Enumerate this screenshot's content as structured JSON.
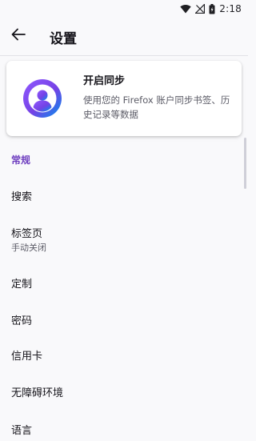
{
  "status_bar": {
    "time": "2:18"
  },
  "app_bar": {
    "title": "设置"
  },
  "sync_card": {
    "title": "开启同步",
    "description": "使用您的 Firefox 账户同步书签、历史记录等数据"
  },
  "section": {
    "title": "常规"
  },
  "items": [
    {
      "label": "搜索",
      "sub": ""
    },
    {
      "label": "标签页",
      "sub": "手动关闭"
    },
    {
      "label": "定制",
      "sub": ""
    },
    {
      "label": "密码",
      "sub": ""
    },
    {
      "label": "信用卡",
      "sub": ""
    },
    {
      "label": "无障碍环境",
      "sub": ""
    },
    {
      "label": "语言",
      "sub": ""
    }
  ],
  "colors": {
    "accent": "#6e3ebf",
    "text": "#15141a",
    "secondary": "#5b5b66",
    "background": "#f9f9fb"
  },
  "icons": [
    "wifi-icon",
    "signal-icon",
    "battery-icon",
    "back-arrow-icon",
    "account-avatar-icon"
  ]
}
